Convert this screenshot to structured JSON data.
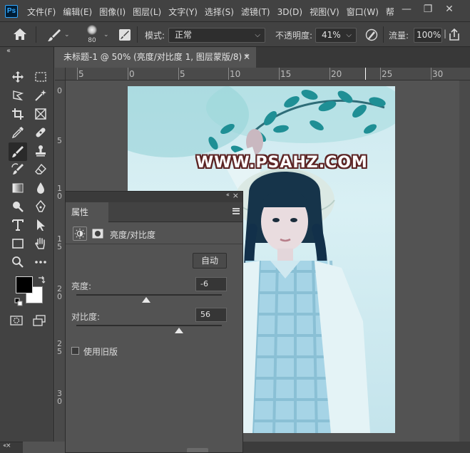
{
  "app": {
    "logo": "Ps",
    "menu": [
      "文件(F)",
      "编辑(E)",
      "图像(I)",
      "图层(L)",
      "文字(Y)",
      "选择(S)",
      "滤镜(T)",
      "3D(D)",
      "视图(V)",
      "窗口(W)",
      "帮"
    ],
    "window_controls": {
      "minimize": "—",
      "restore": "❐",
      "close": "✕"
    }
  },
  "options_bar": {
    "brush_size": "80",
    "mode_label": "模式:",
    "mode_value": "正常",
    "opacity_label": "不透明度:",
    "opacity_value": "41%",
    "flow_label": "流量:",
    "flow_value": "100%"
  },
  "document": {
    "tab_title": "未标题-1 @ 50% (亮度/对比度 1, 图层蒙版/8) *",
    "tab_close": "✕",
    "ruler_top_labels": [
      "5",
      "0",
      "5",
      "10",
      "15",
      "20",
      "25",
      "30"
    ],
    "ruler_left_labels": [
      "0",
      "5",
      "1 0",
      "1 5",
      "2 0",
      "2 5",
      "3 0"
    ],
    "watermark": "WWW.PSAHZ.COM"
  },
  "properties_panel": {
    "tab_label": "属性",
    "adjustment_title": "亮度/对比度",
    "auto_button": "自动",
    "brightness_label": "亮度:",
    "brightness_value": "-6",
    "contrast_label": "对比度:",
    "contrast_value": "56",
    "legacy_label": "使用旧版",
    "legacy_checked": false
  },
  "colors": {
    "foreground": "#000000",
    "background": "#ffffff",
    "accent": "#31a8ff"
  }
}
